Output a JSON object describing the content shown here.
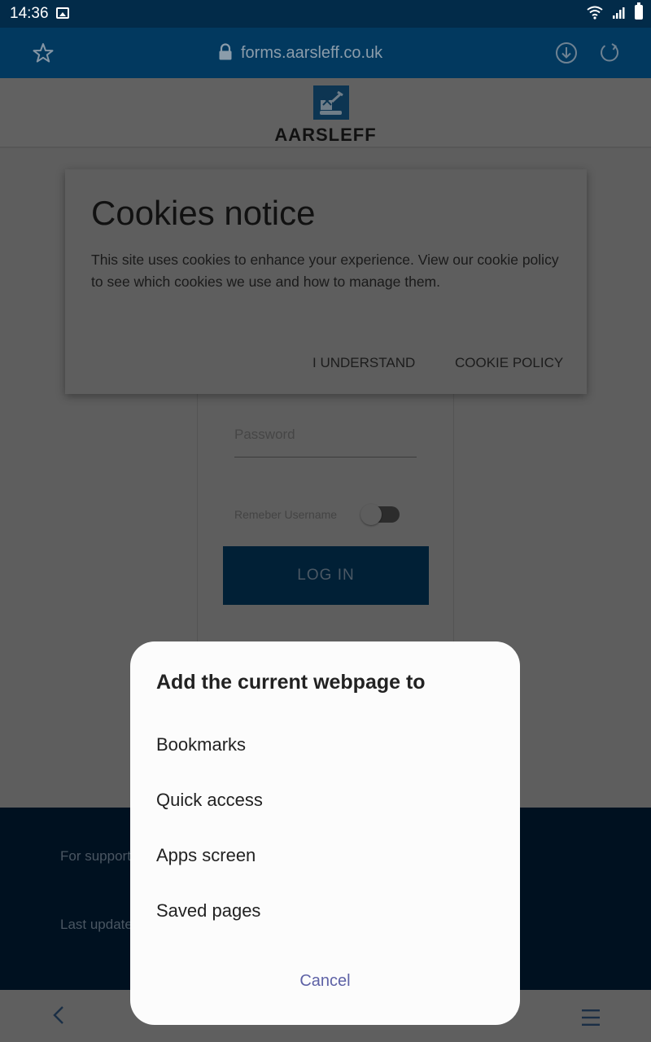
{
  "status_bar": {
    "time": "14:36",
    "icons": [
      "gallery-icon",
      "wifi-icon",
      "signal-icon",
      "battery-icon"
    ]
  },
  "browser": {
    "url": "forms.aarsleff.co.uk",
    "icons": [
      "star-icon",
      "lock-icon",
      "download-icon",
      "reload-icon"
    ]
  },
  "header": {
    "logo_text": "AARSLEFF"
  },
  "login": {
    "password_placeholder": "Password",
    "remember_label": "Remeber Username",
    "remember_on": false,
    "login_button": "LOG IN"
  },
  "footer": {
    "support_text": "For support",
    "updated_text": "Last updated"
  },
  "cookie_dialog": {
    "title": "Cookies notice",
    "body": "This site uses cookies to enhance your experience. View our cookie policy to see which cookies we use and how to manage them.",
    "understand_button": "I UNDERSTAND",
    "policy_button": "COOKIE POLICY"
  },
  "add_sheet": {
    "title": "Add the current webpage to",
    "items": [
      {
        "label": "Bookmarks"
      },
      {
        "label": "Quick access"
      },
      {
        "label": "Apps screen"
      },
      {
        "label": "Saved pages"
      }
    ],
    "cancel": "Cancel"
  },
  "colors": {
    "status_bar": "#022b49",
    "browser_bar": "#02395f",
    "overlay_page": "#5e5e5e",
    "cancel_accent": "#5e62a6"
  }
}
